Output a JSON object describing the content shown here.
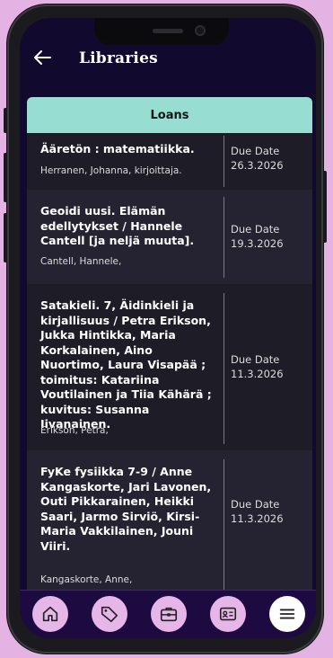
{
  "header": {
    "title": "Libraries"
  },
  "table": {
    "heading": "Loans"
  },
  "loans": [
    {
      "title": "Ääretön : matematiikka.",
      "author": "Herranen, Johanna, kirjoittaja.",
      "due_label": "Due Date",
      "due_date": "26.3.2026"
    },
    {
      "title": "Geoidi uusi. Elämän edellytykset / Hannele Cantell [ja neljä muuta].",
      "author": "Cantell, Hannele,",
      "due_label": "Due Date",
      "due_date": "19.3.2026"
    },
    {
      "title": "Satakieli. 7, Äidinkieli ja kirjallisuus / Petra Erikson, Jukka Hintikka, Maria Korkalainen, Aino Nuortimo, Laura Visapää ; toimitus: Katariina Voutilainen ja Tiia Kähärä ; kuvitus: Susanna Iivanainen.",
      "author": "Erikson, Petra,",
      "due_label": "Due Date",
      "due_date": "11.3.2026"
    },
    {
      "title": "FyKe fysiikka 7-9 / Anne Kangaskorte, Jari Lavonen, Outi Pikkarainen, Heikki Saari, Jarmo Sirviö, Kirsi-Maria Vakkilainen, Jouni Viiri.",
      "author": "Kangaskorte, Anne,",
      "due_label": "Due Date",
      "due_date": "11.3.2026"
    }
  ],
  "tabbar": {
    "items": [
      {
        "icon": "home-icon"
      },
      {
        "icon": "tag-icon"
      },
      {
        "icon": "briefcase-icon"
      },
      {
        "icon": "id-card-icon"
      },
      {
        "icon": "menu-icon",
        "selected": true
      }
    ]
  },
  "colors": {
    "screen_bg": "#120a2e",
    "loans_header_bg": "#97ddd1",
    "row_dark": "#1e1c27",
    "row_light": "#252331",
    "tab_bg": "#1d0a40",
    "tab_button": "#e6b6e8",
    "tab_selected": "#ffffff"
  }
}
